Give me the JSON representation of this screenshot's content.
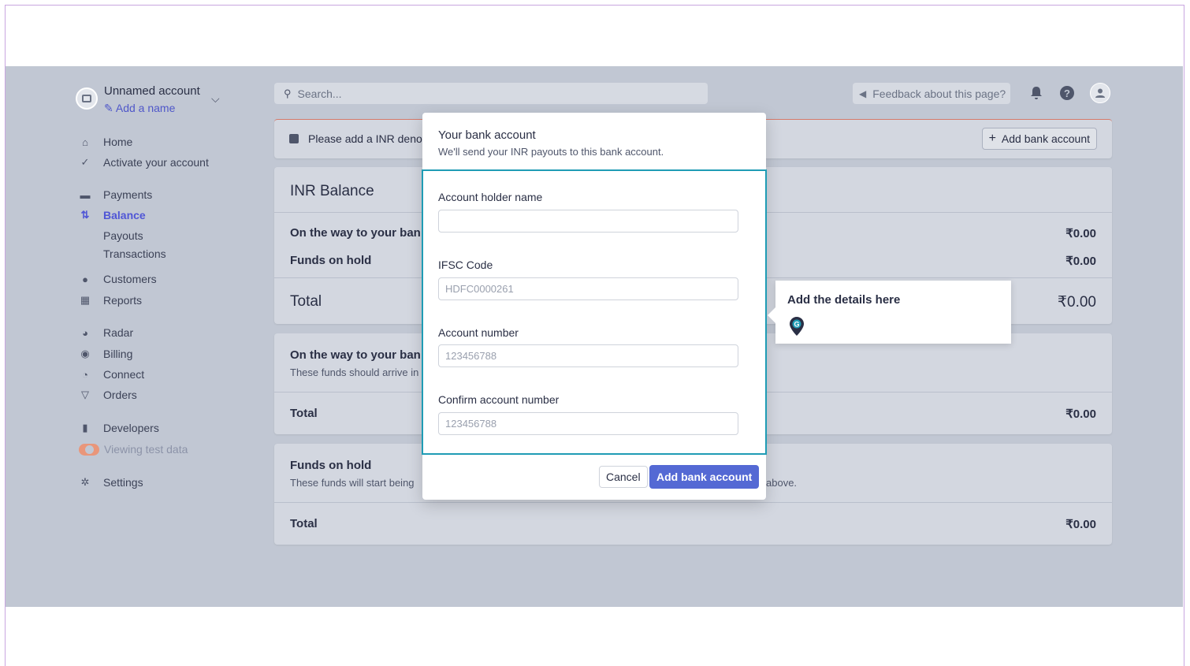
{
  "account": {
    "name": "Unnamed account",
    "add_name": "Add a name"
  },
  "search": {
    "placeholder": "Search..."
  },
  "topbar": {
    "feedback": "Feedback about this page?"
  },
  "sidebar": {
    "items": [
      {
        "label": "Home",
        "icon": "home-icon"
      },
      {
        "label": "Activate your account",
        "icon": "check-icon"
      },
      {
        "label": "Payments",
        "icon": "wallet-icon"
      },
      {
        "label": "Balance",
        "icon": "transfer-arrows-icon",
        "active": true
      },
      {
        "label": "Payouts"
      },
      {
        "label": "Transactions"
      },
      {
        "label": "Customers",
        "icon": "user-icon"
      },
      {
        "label": "Reports",
        "icon": "reports-icon"
      },
      {
        "label": "Radar",
        "icon": "radar-icon"
      },
      {
        "label": "Billing",
        "icon": "billing-icon"
      },
      {
        "label": "Connect",
        "icon": "connect-icon"
      },
      {
        "label": "Orders",
        "icon": "orders-icon"
      },
      {
        "label": "Developers",
        "icon": "terminal-icon"
      },
      {
        "label": "Viewing test data",
        "icon": "toggle"
      },
      {
        "label": "Settings",
        "icon": "gear-icon"
      }
    ]
  },
  "alert": {
    "text": "Please add a INR denor",
    "add_button": "Add bank account"
  },
  "balance_card": {
    "title": "INR Balance",
    "rows": [
      {
        "label": "On the way to your ban",
        "value": "₹0.00"
      },
      {
        "label": "Funds on hold",
        "value": "₹0.00"
      }
    ],
    "total_label": "Total",
    "total_value": "₹0.00"
  },
  "way_card": {
    "title": "On the way to your ban",
    "subtitle": "These funds should arrive in",
    "total_label": "Total",
    "total_value": "₹0.00"
  },
  "hold_card": {
    "title": "Funds on hold",
    "subtitle": "These funds will start being",
    "subtitle_tail": "above.",
    "total_label": "Total",
    "total_value": "₹0.00"
  },
  "modal": {
    "title": "Your bank account",
    "subtitle": "We'll send your INR payouts to this bank account.",
    "fields": [
      {
        "label": "Account holder name",
        "placeholder": ""
      },
      {
        "label": "IFSC Code",
        "placeholder": "HDFC0000261"
      },
      {
        "label": "Account number",
        "placeholder": "123456788"
      },
      {
        "label": "Confirm account number",
        "placeholder": "123456788"
      }
    ],
    "cancel": "Cancel",
    "submit": "Add bank account"
  },
  "tooltip": {
    "text": "Add the details here"
  },
  "colors": {
    "accent": "#5469d4",
    "highlight_border": "#1f9cb5",
    "sidebar_active": "#5056d6"
  }
}
